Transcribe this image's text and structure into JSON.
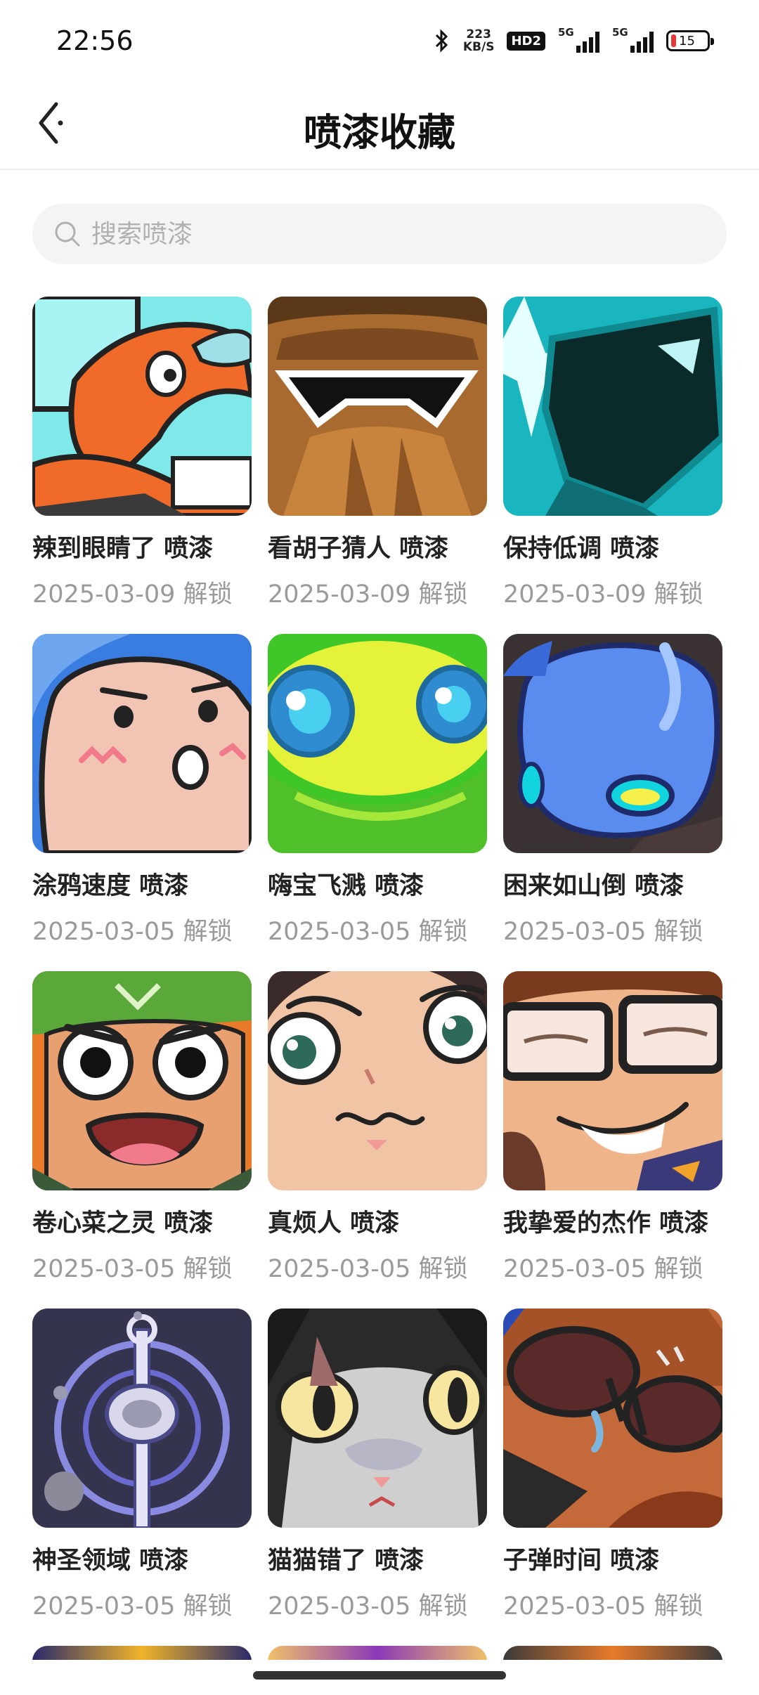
{
  "status_bar": {
    "time": "22:56",
    "net_speed_value": "223",
    "net_speed_unit": "KB/S",
    "hd_label": "HD2",
    "signal1_label": "5G",
    "signal2_label": "5G",
    "battery_level": "15"
  },
  "header": {
    "title": "喷漆收藏"
  },
  "search": {
    "placeholder": "搜索喷漆"
  },
  "items": [
    {
      "name": "辣到眼睛了 喷漆",
      "date": "2025-03-09 解锁"
    },
    {
      "name": "看胡子猜人 喷漆",
      "date": "2025-03-09 解锁"
    },
    {
      "name": "保持低调 喷漆",
      "date": "2025-03-09 解锁"
    },
    {
      "name": "涂鸦速度 喷漆",
      "date": "2025-03-05 解锁"
    },
    {
      "name": "嗨宝飞溅 喷漆",
      "date": "2025-03-05 解锁"
    },
    {
      "name": "困来如山倒 喷漆",
      "date": "2025-03-05 解锁"
    },
    {
      "name": "卷心菜之灵 喷漆",
      "date": "2025-03-05 解锁"
    },
    {
      "name": "真烦人 喷漆",
      "date": "2025-03-05 解锁"
    },
    {
      "name": "我挚爱的杰作 喷漆",
      "date": "2025-03-05 解锁"
    },
    {
      "name": "神圣领域 喷漆",
      "date": "2025-03-05 解锁"
    },
    {
      "name": "猫猫错了 喷漆",
      "date": "2025-03-05 解锁"
    },
    {
      "name": "子弹时间 喷漆",
      "date": "2025-03-05 解锁"
    }
  ],
  "colors": {
    "accent_text": "#222222",
    "date_text": "#9a9a9a",
    "search_bg": "#f4f4f4",
    "battery_low": "#e53935"
  }
}
